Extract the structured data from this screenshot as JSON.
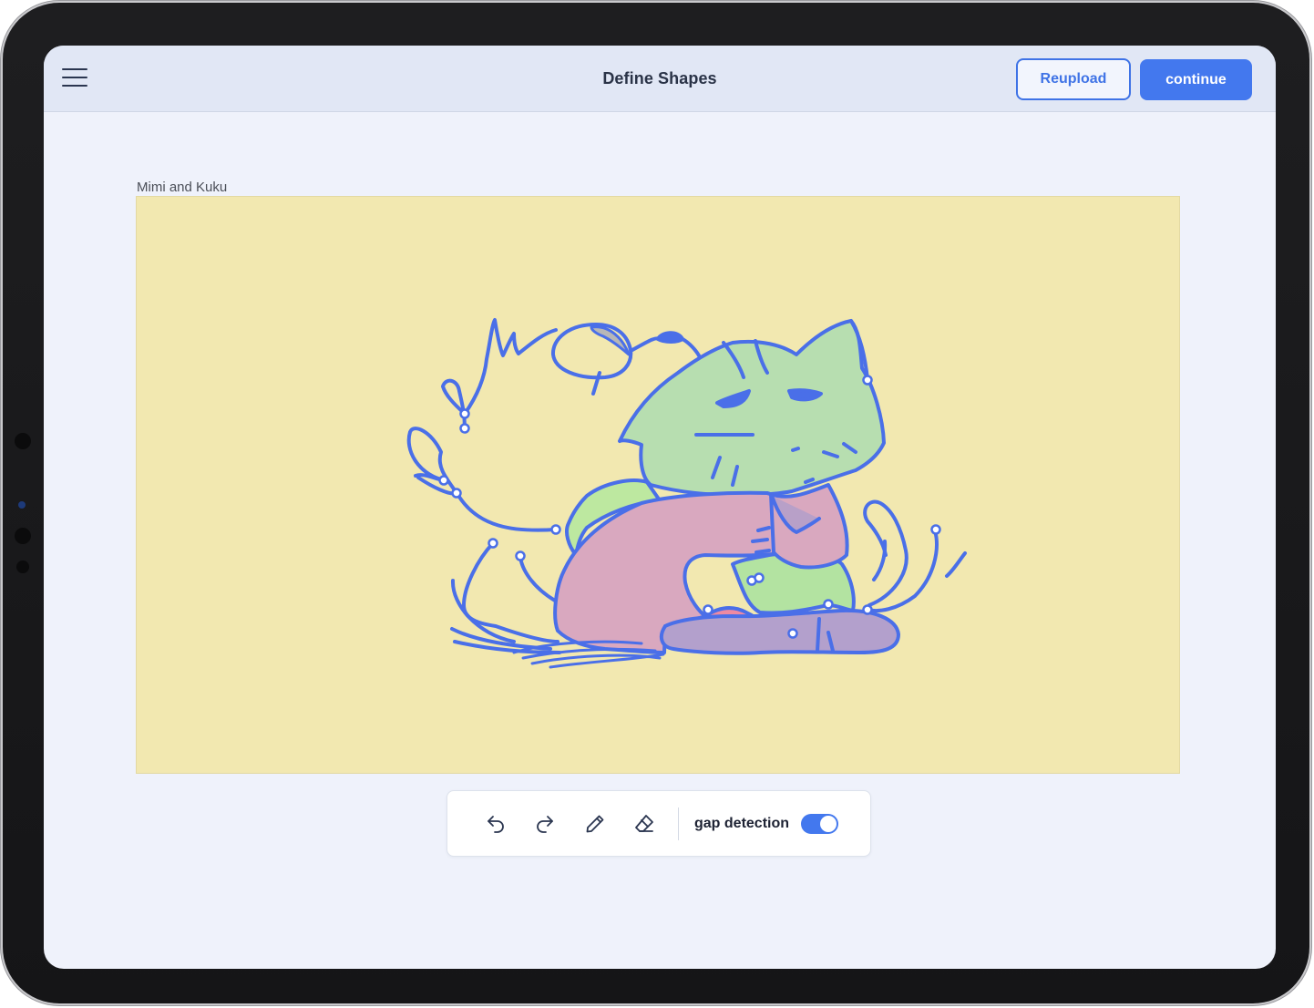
{
  "header": {
    "title": "Define Shapes",
    "reupload_label": "Reupload",
    "continue_label": "continue",
    "menu_icon": "hamburger-menu-icon"
  },
  "canvas": {
    "title": "Mimi and Kuku",
    "background_color": "#f2e8b0",
    "stroke_color": "#4a6fe8"
  },
  "toolbar": {
    "tools": [
      {
        "name": "undo",
        "icon": "undo-icon"
      },
      {
        "name": "redo",
        "icon": "redo-icon"
      },
      {
        "name": "pencil",
        "icon": "pencil-icon"
      },
      {
        "name": "eraser",
        "icon": "eraser-icon"
      }
    ],
    "gap_detection_label": "gap detection",
    "gap_detection_on": true
  },
  "colors": {
    "accent": "#4378ee",
    "topbar": "#e1e7f5",
    "screen_bg": "#eff2fb"
  }
}
